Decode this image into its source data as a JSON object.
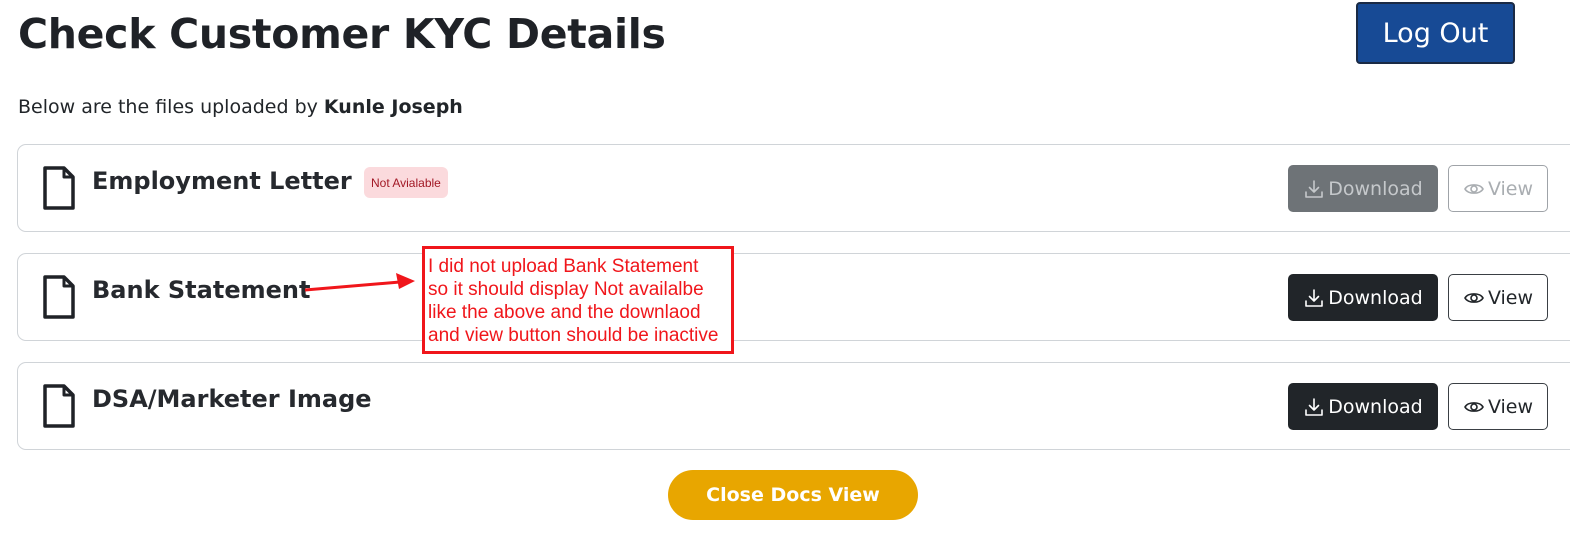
{
  "header": {
    "title": "Check Customer KYC Details",
    "logout_label": "Log Out"
  },
  "intro": {
    "text": "Below are the files uploaded by ",
    "customer_name": "Kunle Joseph"
  },
  "documents": [
    {
      "title": "Employment Letter",
      "status": "Not Avialable",
      "download_label": "Download",
      "view_label": "View",
      "available": false
    },
    {
      "title": "Bank Statement",
      "download_label": "Download",
      "view_label": "View",
      "available": true
    },
    {
      "title": "DSA/Marketer Image",
      "download_label": "Download",
      "view_label": "View",
      "available": true
    }
  ],
  "annotation": {
    "lines": [
      "I did not upload Bank Statement",
      "so it should display Not availalbe",
      "like the above and the downlaod",
      "and view button should be inactive"
    ],
    "color": "#f0161b"
  },
  "footer": {
    "close_label": "Close Docs View"
  },
  "colors": {
    "logout_bg": "#174a95",
    "download_bg": "#212529",
    "download_disabled_bg": "#6e7377",
    "badge_bg": "#fbdadd",
    "badge_text": "#a21825",
    "close_bg": "#e8a600"
  }
}
